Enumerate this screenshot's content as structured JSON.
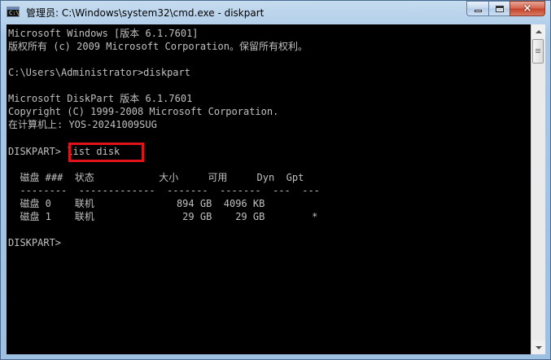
{
  "window": {
    "title": "管理员: C:\\Windows\\system32\\cmd.exe - diskpart",
    "icon_prompt": "C:\\",
    "controls": {
      "minimize": "minimize",
      "maximize": "maximize",
      "close": "×"
    },
    "icons": [
      "cmd-app-icon",
      "minimize-icon",
      "maximize-icon",
      "close-icon",
      "scroll-up-icon",
      "scroll-down-icon"
    ]
  },
  "console": {
    "lines": [
      "Microsoft Windows [版本 6.1.7601]",
      "版权所有 (c) 2009 Microsoft Corporation。保留所有权利。",
      "",
      "C:\\Users\\Administrator>diskpart",
      "",
      "Microsoft DiskPart 版本 6.1.7601",
      "Copyright (C) 1999-2008 Microsoft Corporation.",
      "在计算机上: YOS-20241009SUG",
      "",
      "DISKPART> list disk",
      "",
      "  磁盘 ###  状态           大小     可用     Dyn  Gpt",
      "  --------  -------------  -------  -------  ---  ---",
      "  磁盘 0    联机              894 GB  4096 KB",
      "  磁盘 1    联机               29 GB    29 GB        *",
      "",
      "DISKPART> "
    ],
    "highlighted_command": "list disk",
    "highlight_color": "#e0121a",
    "text_color": "#c0c0c0",
    "background": "#000000"
  }
}
